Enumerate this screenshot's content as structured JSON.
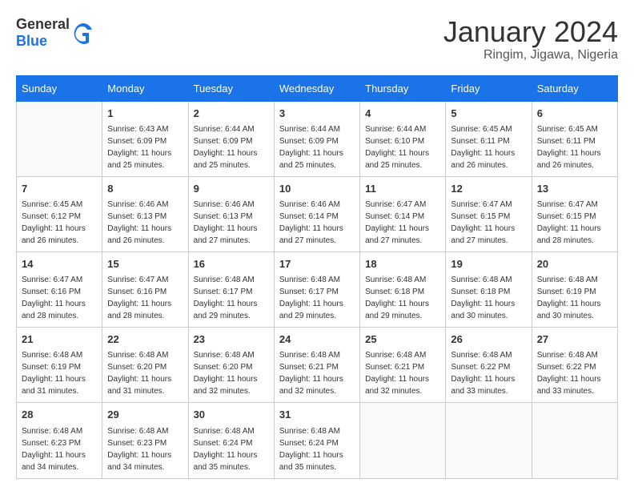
{
  "header": {
    "logo_general": "General",
    "logo_blue": "Blue",
    "title": "January 2024",
    "location": "Ringim, Jigawa, Nigeria"
  },
  "days_of_week": [
    "Sunday",
    "Monday",
    "Tuesday",
    "Wednesday",
    "Thursday",
    "Friday",
    "Saturday"
  ],
  "weeks": [
    [
      {
        "day": "",
        "info": ""
      },
      {
        "day": "1",
        "sunrise": "6:43 AM",
        "sunset": "6:09 PM",
        "daylight": "11 hours and 25 minutes."
      },
      {
        "day": "2",
        "sunrise": "6:44 AM",
        "sunset": "6:09 PM",
        "daylight": "11 hours and 25 minutes."
      },
      {
        "day": "3",
        "sunrise": "6:44 AM",
        "sunset": "6:09 PM",
        "daylight": "11 hours and 25 minutes."
      },
      {
        "day": "4",
        "sunrise": "6:44 AM",
        "sunset": "6:10 PM",
        "daylight": "11 hours and 25 minutes."
      },
      {
        "day": "5",
        "sunrise": "6:45 AM",
        "sunset": "6:11 PM",
        "daylight": "11 hours and 26 minutes."
      },
      {
        "day": "6",
        "sunrise": "6:45 AM",
        "sunset": "6:11 PM",
        "daylight": "11 hours and 26 minutes."
      }
    ],
    [
      {
        "day": "7",
        "sunrise": "6:45 AM",
        "sunset": "6:12 PM",
        "daylight": "11 hours and 26 minutes."
      },
      {
        "day": "8",
        "sunrise": "6:46 AM",
        "sunset": "6:13 PM",
        "daylight": "11 hours and 26 minutes."
      },
      {
        "day": "9",
        "sunrise": "6:46 AM",
        "sunset": "6:13 PM",
        "daylight": "11 hours and 27 minutes."
      },
      {
        "day": "10",
        "sunrise": "6:46 AM",
        "sunset": "6:14 PM",
        "daylight": "11 hours and 27 minutes."
      },
      {
        "day": "11",
        "sunrise": "6:47 AM",
        "sunset": "6:14 PM",
        "daylight": "11 hours and 27 minutes."
      },
      {
        "day": "12",
        "sunrise": "6:47 AM",
        "sunset": "6:15 PM",
        "daylight": "11 hours and 27 minutes."
      },
      {
        "day": "13",
        "sunrise": "6:47 AM",
        "sunset": "6:15 PM",
        "daylight": "11 hours and 28 minutes."
      }
    ],
    [
      {
        "day": "14",
        "sunrise": "6:47 AM",
        "sunset": "6:16 PM",
        "daylight": "11 hours and 28 minutes."
      },
      {
        "day": "15",
        "sunrise": "6:47 AM",
        "sunset": "6:16 PM",
        "daylight": "11 hours and 28 minutes."
      },
      {
        "day": "16",
        "sunrise": "6:48 AM",
        "sunset": "6:17 PM",
        "daylight": "11 hours and 29 minutes."
      },
      {
        "day": "17",
        "sunrise": "6:48 AM",
        "sunset": "6:17 PM",
        "daylight": "11 hours and 29 minutes."
      },
      {
        "day": "18",
        "sunrise": "6:48 AM",
        "sunset": "6:18 PM",
        "daylight": "11 hours and 29 minutes."
      },
      {
        "day": "19",
        "sunrise": "6:48 AM",
        "sunset": "6:18 PM",
        "daylight": "11 hours and 30 minutes."
      },
      {
        "day": "20",
        "sunrise": "6:48 AM",
        "sunset": "6:19 PM",
        "daylight": "11 hours and 30 minutes."
      }
    ],
    [
      {
        "day": "21",
        "sunrise": "6:48 AM",
        "sunset": "6:19 PM",
        "daylight": "11 hours and 31 minutes."
      },
      {
        "day": "22",
        "sunrise": "6:48 AM",
        "sunset": "6:20 PM",
        "daylight": "11 hours and 31 minutes."
      },
      {
        "day": "23",
        "sunrise": "6:48 AM",
        "sunset": "6:20 PM",
        "daylight": "11 hours and 32 minutes."
      },
      {
        "day": "24",
        "sunrise": "6:48 AM",
        "sunset": "6:21 PM",
        "daylight": "11 hours and 32 minutes."
      },
      {
        "day": "25",
        "sunrise": "6:48 AM",
        "sunset": "6:21 PM",
        "daylight": "11 hours and 32 minutes."
      },
      {
        "day": "26",
        "sunrise": "6:48 AM",
        "sunset": "6:22 PM",
        "daylight": "11 hours and 33 minutes."
      },
      {
        "day": "27",
        "sunrise": "6:48 AM",
        "sunset": "6:22 PM",
        "daylight": "11 hours and 33 minutes."
      }
    ],
    [
      {
        "day": "28",
        "sunrise": "6:48 AM",
        "sunset": "6:23 PM",
        "daylight": "11 hours and 34 minutes."
      },
      {
        "day": "29",
        "sunrise": "6:48 AM",
        "sunset": "6:23 PM",
        "daylight": "11 hours and 34 minutes."
      },
      {
        "day": "30",
        "sunrise": "6:48 AM",
        "sunset": "6:24 PM",
        "daylight": "11 hours and 35 minutes."
      },
      {
        "day": "31",
        "sunrise": "6:48 AM",
        "sunset": "6:24 PM",
        "daylight": "11 hours and 35 minutes."
      },
      {
        "day": "",
        "info": ""
      },
      {
        "day": "",
        "info": ""
      },
      {
        "day": "",
        "info": ""
      }
    ]
  ],
  "labels": {
    "sunrise": "Sunrise:",
    "sunset": "Sunset:",
    "daylight": "Daylight:"
  }
}
